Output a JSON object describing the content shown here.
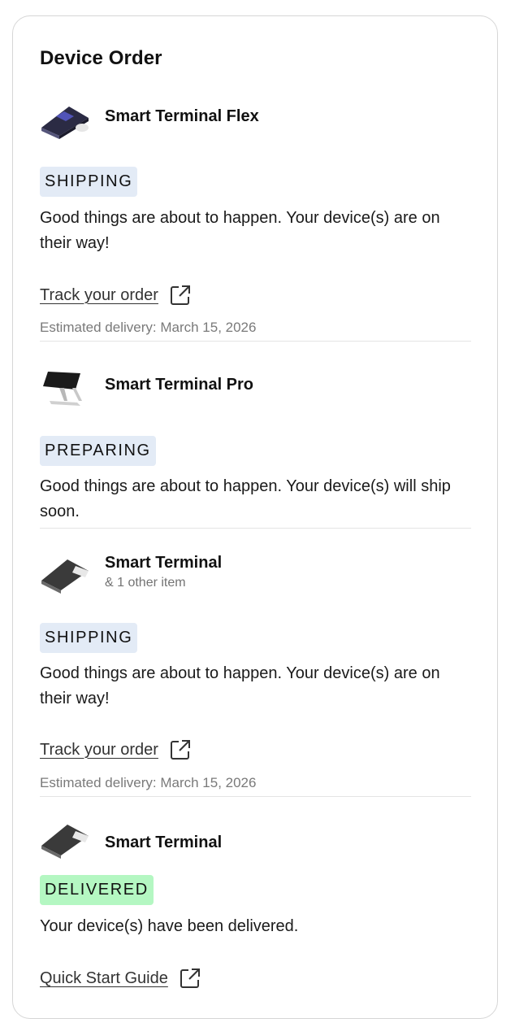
{
  "card": {
    "title": "Device Order"
  },
  "orders": [
    {
      "product_name": "Smart Terminal Flex",
      "product_sub": "",
      "status": "SHIPPING",
      "message": "Good things are about to happen. Your device(s) are on their way!",
      "link_label": "Track your order",
      "estimated_delivery": "Estimated delivery: March 15, 2026"
    },
    {
      "product_name": "Smart Terminal Pro",
      "product_sub": "",
      "status": "PREPARING",
      "message": "Good things are about to happen. Your device(s) will ship soon."
    },
    {
      "product_name": "Smart Terminal",
      "product_sub": "& 1 other item",
      "status": "SHIPPING",
      "message": "Good things are about to happen. Your device(s) are on their way!",
      "link_label": "Track your order",
      "estimated_delivery": "Estimated delivery: March 15, 2026"
    },
    {
      "product_name": "Smart Terminal",
      "product_sub": "",
      "status": "DELIVERED",
      "message": "Your device(s) have been delivered.",
      "link_label": "Quick Start Guide"
    }
  ],
  "colors": {
    "badge_shipping": "#e3ebf6",
    "badge_delivered": "#b4f7c2",
    "muted_text": "#7a7a7a",
    "card_border": "#d6d6d6"
  },
  "icons": [
    "device-flex-icon",
    "device-pro-icon",
    "device-terminal-icon",
    "external-link-icon"
  ]
}
